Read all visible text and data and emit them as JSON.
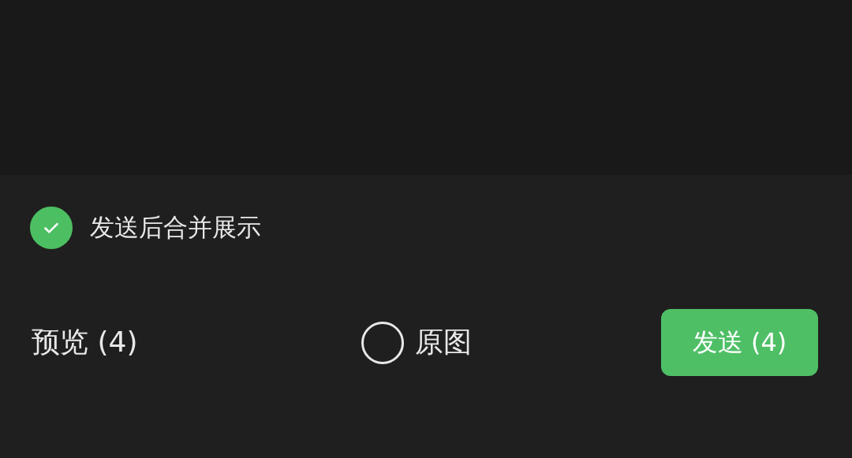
{
  "merge_option": {
    "label": "发送后合并展示",
    "checked": true
  },
  "preview": {
    "label": "预览 (4)"
  },
  "original_image": {
    "label": "原图",
    "checked": false
  },
  "send_button": {
    "label": "发送 (4)"
  }
}
